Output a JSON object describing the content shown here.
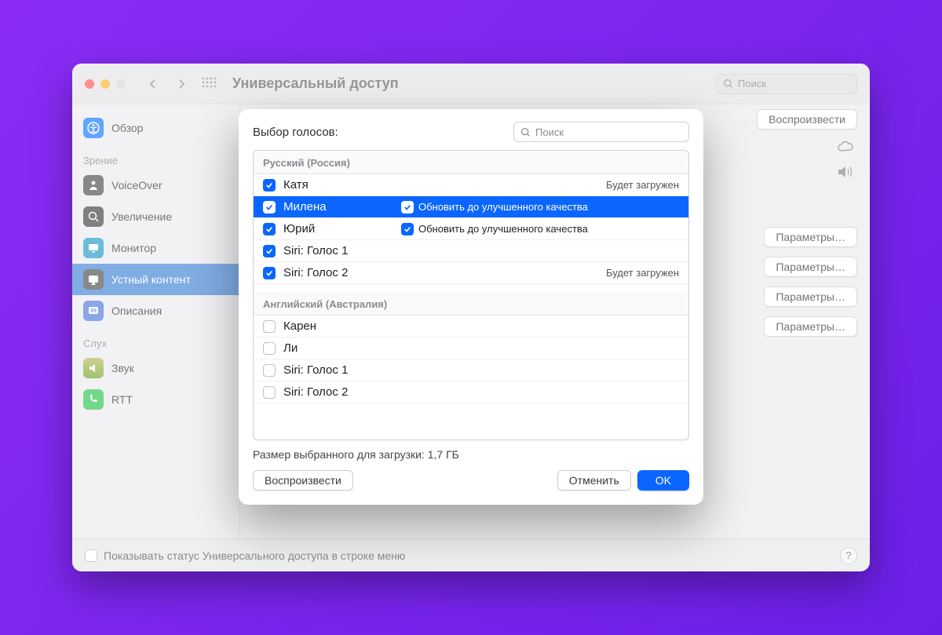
{
  "titlebar": {
    "title": "Универсальный доступ",
    "search_placeholder": "Поиск"
  },
  "sidebar": {
    "section_vision": "Зрение",
    "section_hearing": "Слух",
    "overview": "Обзор",
    "voiceover": "VoiceOver",
    "zoom": "Увеличение",
    "monitor": "Монитор",
    "speech": "Устный контент",
    "descriptions": "Описания",
    "sound": "Звук",
    "rtt": "RTT"
  },
  "main": {
    "play": "Воспроизвести",
    "params": "Параметры…"
  },
  "footer": {
    "show_status": "Показывать статус Универсального доступа в строке меню"
  },
  "modal": {
    "title": "Выбор голосов:",
    "search_placeholder": "Поиск",
    "group_ru": "Русский (Россия)",
    "group_en_au": "Английский (Австралия)",
    "voices_ru": [
      {
        "name": "Катя",
        "checked": true,
        "status": "Будет загружен",
        "upgrade": false,
        "selected": false
      },
      {
        "name": "Милена",
        "checked": true,
        "status": "",
        "upgrade": true,
        "upgrade_label": "Обновить до улучшенного качества",
        "selected": true
      },
      {
        "name": "Юрий",
        "checked": true,
        "status": "",
        "upgrade": true,
        "upgrade_label": "Обновить до улучшенного качества",
        "selected": false
      },
      {
        "name": "Siri: Голос 1",
        "checked": true,
        "status": "",
        "upgrade": false,
        "selected": false
      },
      {
        "name": "Siri: Голос 2",
        "checked": true,
        "status": "Будет загружен",
        "upgrade": false,
        "selected": false
      }
    ],
    "voices_en_au": [
      {
        "name": "Карен",
        "checked": false
      },
      {
        "name": "Ли",
        "checked": false
      },
      {
        "name": "Siri: Голос 1",
        "checked": false
      },
      {
        "name": "Siri: Голос 2",
        "checked": false
      }
    ],
    "download_size": "Размер выбранного для загрузки: 1,7 ГБ",
    "play": "Воспроизвести",
    "cancel": "Отменить",
    "ok": "OK"
  }
}
